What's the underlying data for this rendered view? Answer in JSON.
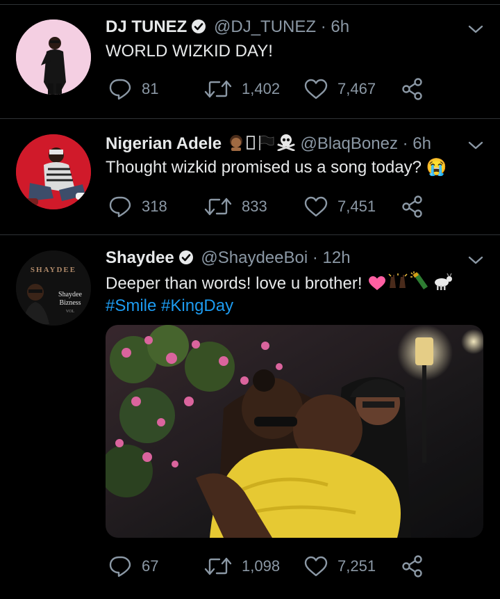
{
  "tweets": [
    {
      "name": "DJ TUNEZ",
      "handle": "@DJ_TUNEZ",
      "time": "6h",
      "text": "WORLD WIZKID DAY!",
      "replies": "81",
      "retweets": "1,402",
      "likes": "7,467"
    },
    {
      "name": "Nigerian Adele",
      "handle": "@BlaqBonez",
      "time": "6h",
      "text": "Thought wizkid promised us a song today? 😭",
      "replies": "318",
      "retweets": "833",
      "likes": "7,451"
    },
    {
      "name": "Shaydee",
      "handle": "@ShaydeeBoi",
      "time": "12h",
      "text": "Deeper than words! love u brother!",
      "hashtags": [
        "#Smile",
        "#KingDay"
      ],
      "avatar_text": {
        "top": "SHAYDEE",
        "line1": "Shaydee",
        "line2": "Bizness",
        "line3": "VOL"
      },
      "replies": "67",
      "retweets": "1,098",
      "likes": "7,251"
    }
  ],
  "separator": "·",
  "colors": {
    "background": "#000000",
    "secondary": "#8b98a5",
    "link": "#1d9bf0",
    "divider": "#2f3336"
  }
}
